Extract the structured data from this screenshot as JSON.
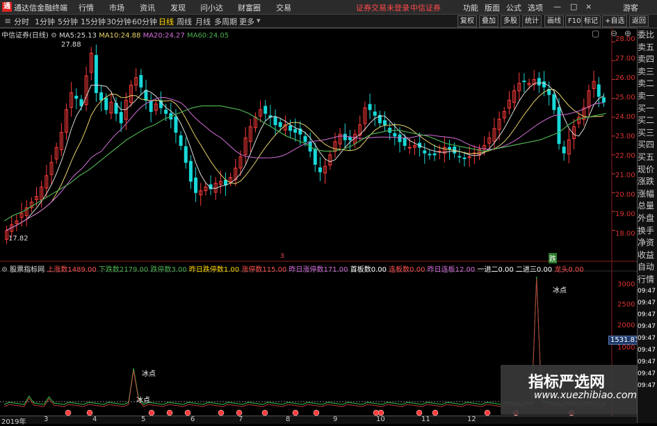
{
  "titlebar": {
    "logo": "通",
    "app_title": "通达信金融终端",
    "menus": [
      "行情",
      "市场",
      "资讯",
      "发现",
      "问小达",
      "财富圈",
      "交易"
    ],
    "status": "证券交易未登录",
    "broker": "中信证券",
    "right_menus": [
      "功能",
      "版面",
      "公式",
      "选项"
    ],
    "guest": "游客",
    "window_controls": [
      "—",
      "□",
      "×"
    ]
  },
  "periodbar": {
    "periods": [
      "分时",
      "1分钟",
      "5分钟",
      "15分钟",
      "30分钟",
      "60分钟",
      "日线",
      "周线",
      "月线",
      "多周期",
      "更多"
    ],
    "active": "日线",
    "right_buttons": [
      "复权",
      "叠加",
      "多股",
      "统计",
      "画线",
      "F10",
      "标记",
      "+自选",
      "返回"
    ]
  },
  "main_chart": {
    "stock": "中信证券(日线)",
    "ma": [
      {
        "label": "MA5:",
        "value": "25.13",
        "color": "#dddddd"
      },
      {
        "label": "MA10:",
        "value": "24.88",
        "color": "#e8d36a"
      },
      {
        "label": "MA20:",
        "value": "24.27",
        "color": "#d36fd9"
      },
      {
        "label": "MA60:",
        "value": "24.05",
        "color": "#4caf50"
      }
    ],
    "y_ticks": [
      "28.00",
      "27.00",
      "26.00",
      "25.00",
      "24.00",
      "23.00",
      "22.00",
      "21.00",
      "20.00",
      "19.00",
      "18.00"
    ],
    "high_label": "27.88",
    "low_label": "17.82",
    "marker_3": "3",
    "marker_die": "跌"
  },
  "chart_data": {
    "type": "candlestick",
    "ylim": [
      17.5,
      28.3
    ],
    "close": [
      18.0,
      18.3,
      18.5,
      18.9,
      19.2,
      19.5,
      19.8,
      20.3,
      20.9,
      21.6,
      22.4,
      23.2,
      24.4,
      25.3,
      25.0,
      24.6,
      26.2,
      27.4,
      25.3,
      24.9,
      24.4,
      24.8,
      24.2,
      23.7,
      24.9,
      25.7,
      26.1,
      25.6,
      24.9,
      24.3,
      24.7,
      24.5,
      24.2,
      23.9,
      23.2,
      22.5,
      21.6,
      20.6,
      20.0,
      20.1,
      20.3,
      20.2,
      20.5,
      20.6,
      20.4,
      20.8,
      21.3,
      21.9,
      22.9,
      23.5,
      24.0,
      24.4,
      24.2,
      24.0,
      23.6,
      23.5,
      23.6,
      23.3,
      23.2,
      23.1,
      22.7,
      22.2,
      21.5,
      21.1,
      21.4,
      22.0,
      22.7,
      23.1,
      22.8,
      22.8,
      23.1,
      23.6,
      24.5,
      24.4,
      24.1,
      23.7,
      23.6,
      23.2,
      23.0,
      22.7,
      22.5,
      22.4,
      22.5,
      22.4,
      22.1,
      22.0,
      22.0,
      22.2,
      22.4,
      22.3,
      22.1,
      21.9,
      21.8,
      21.9,
      22.1,
      22.3,
      22.5,
      22.9,
      23.4,
      23.9,
      24.3,
      24.9,
      25.4,
      25.8,
      25.9,
      25.8,
      26.0,
      25.7,
      25.6,
      25.2,
      24.4,
      22.6,
      22.1,
      22.8,
      23.5,
      24.0,
      24.5,
      25.4,
      25.9,
      25.1,
      24.8
    ],
    "ma60": [
      18.5,
      18.8,
      19.0,
      19.3,
      19.6,
      19.9,
      20.2,
      20.5,
      20.9,
      21.2,
      21.6,
      22.0,
      22.4,
      22.8,
      23.1,
      23.4,
      23.6,
      23.9,
      24.1,
      24.3,
      24.5,
      24.6,
      24.6,
      24.6,
      24.5,
      24.4,
      24.2,
      23.9,
      23.6,
      23.3,
      23.0,
      22.8,
      22.6,
      22.3,
      22.2,
      22.2,
      22.3,
      22.5,
      22.8,
      23.1,
      23.2,
      23.3,
      23.3,
      23.2,
      23.1,
      23.0,
      22.8,
      22.6,
      22.5,
      22.4,
      22.3,
      22.2,
      22.3,
      22.4,
      22.5,
      22.6,
      22.7,
      22.8,
      23.0,
      23.2,
      23.6,
      23.9,
      24.0,
      24.1,
      24.2
    ],
    "indicator": {
      "name": "股票指标网",
      "yticks": [
        "3000",
        "2500",
        "2000",
        "1500",
        "1000"
      ],
      "current": "1531.81",
      "labels": [
        "冰点",
        "冰点",
        "冰点"
      ]
    }
  },
  "indicator_bar": {
    "items": [
      {
        "label": "上涨数",
        "value": "1489.00",
        "color": "#ff5050"
      },
      {
        "label": "下跌数",
        "value": "2179.00",
        "color": "#4caf50"
      },
      {
        "label": "跌停数",
        "value": "3.00",
        "color": "#4caf50"
      },
      {
        "label": "昨日跌停数",
        "value": "1.00",
        "color": "#ffd700"
      },
      {
        "label": "涨停数",
        "value": "115.00",
        "color": "#ff5050"
      },
      {
        "label": "昨日涨停数",
        "value": "171.00",
        "color": "#d36fd9"
      },
      {
        "label": "首板数",
        "value": "0.00",
        "color": "#ffffff"
      },
      {
        "label": "连板数",
        "value": "0.00",
        "color": "#ff5050"
      },
      {
        "label": "昨日连板",
        "value": "12.00",
        "color": "#d36fd9"
      },
      {
        "label": "一进二",
        "value": "0.00",
        "color": "#ffffff"
      },
      {
        "label": "二进三",
        "value": "0.00",
        "color": "#ffffff"
      },
      {
        "label": "龙头",
        "value": "0.00",
        "color": "#ff5050"
      }
    ]
  },
  "right_panel": {
    "items": [
      "委比",
      "卖五",
      "卖四",
      "卖三",
      "卖二",
      "卖一",
      "买一",
      "买二",
      "买三",
      "买四",
      "买五",
      "现价",
      "涨跌",
      "涨幅",
      "总量",
      "外盘",
      "换手",
      "净资",
      "收益",
      "自动",
      "行情",
      "09:47",
      "09:47",
      "09:47",
      "09:47",
      "09:47",
      "09:47",
      "09:47",
      "09:47",
      "09:47"
    ]
  },
  "xaxis": {
    "labels": [
      "2019年",
      "3",
      "4",
      "5",
      "6",
      "7",
      "8",
      "9",
      "10",
      "11",
      "12"
    ],
    "year": "2019年"
  },
  "watermark": {
    "cn": "指标严选网",
    "url": "www.xuezhibiao.com"
  },
  "colors": {
    "up": "#ff3b3b",
    "down": "#19d8d8",
    "ma5": "#dddddd",
    "ma10": "#e8d36a",
    "ma20": "#d36fd9",
    "ma60": "#4caf50",
    "axis": "#d33"
  }
}
